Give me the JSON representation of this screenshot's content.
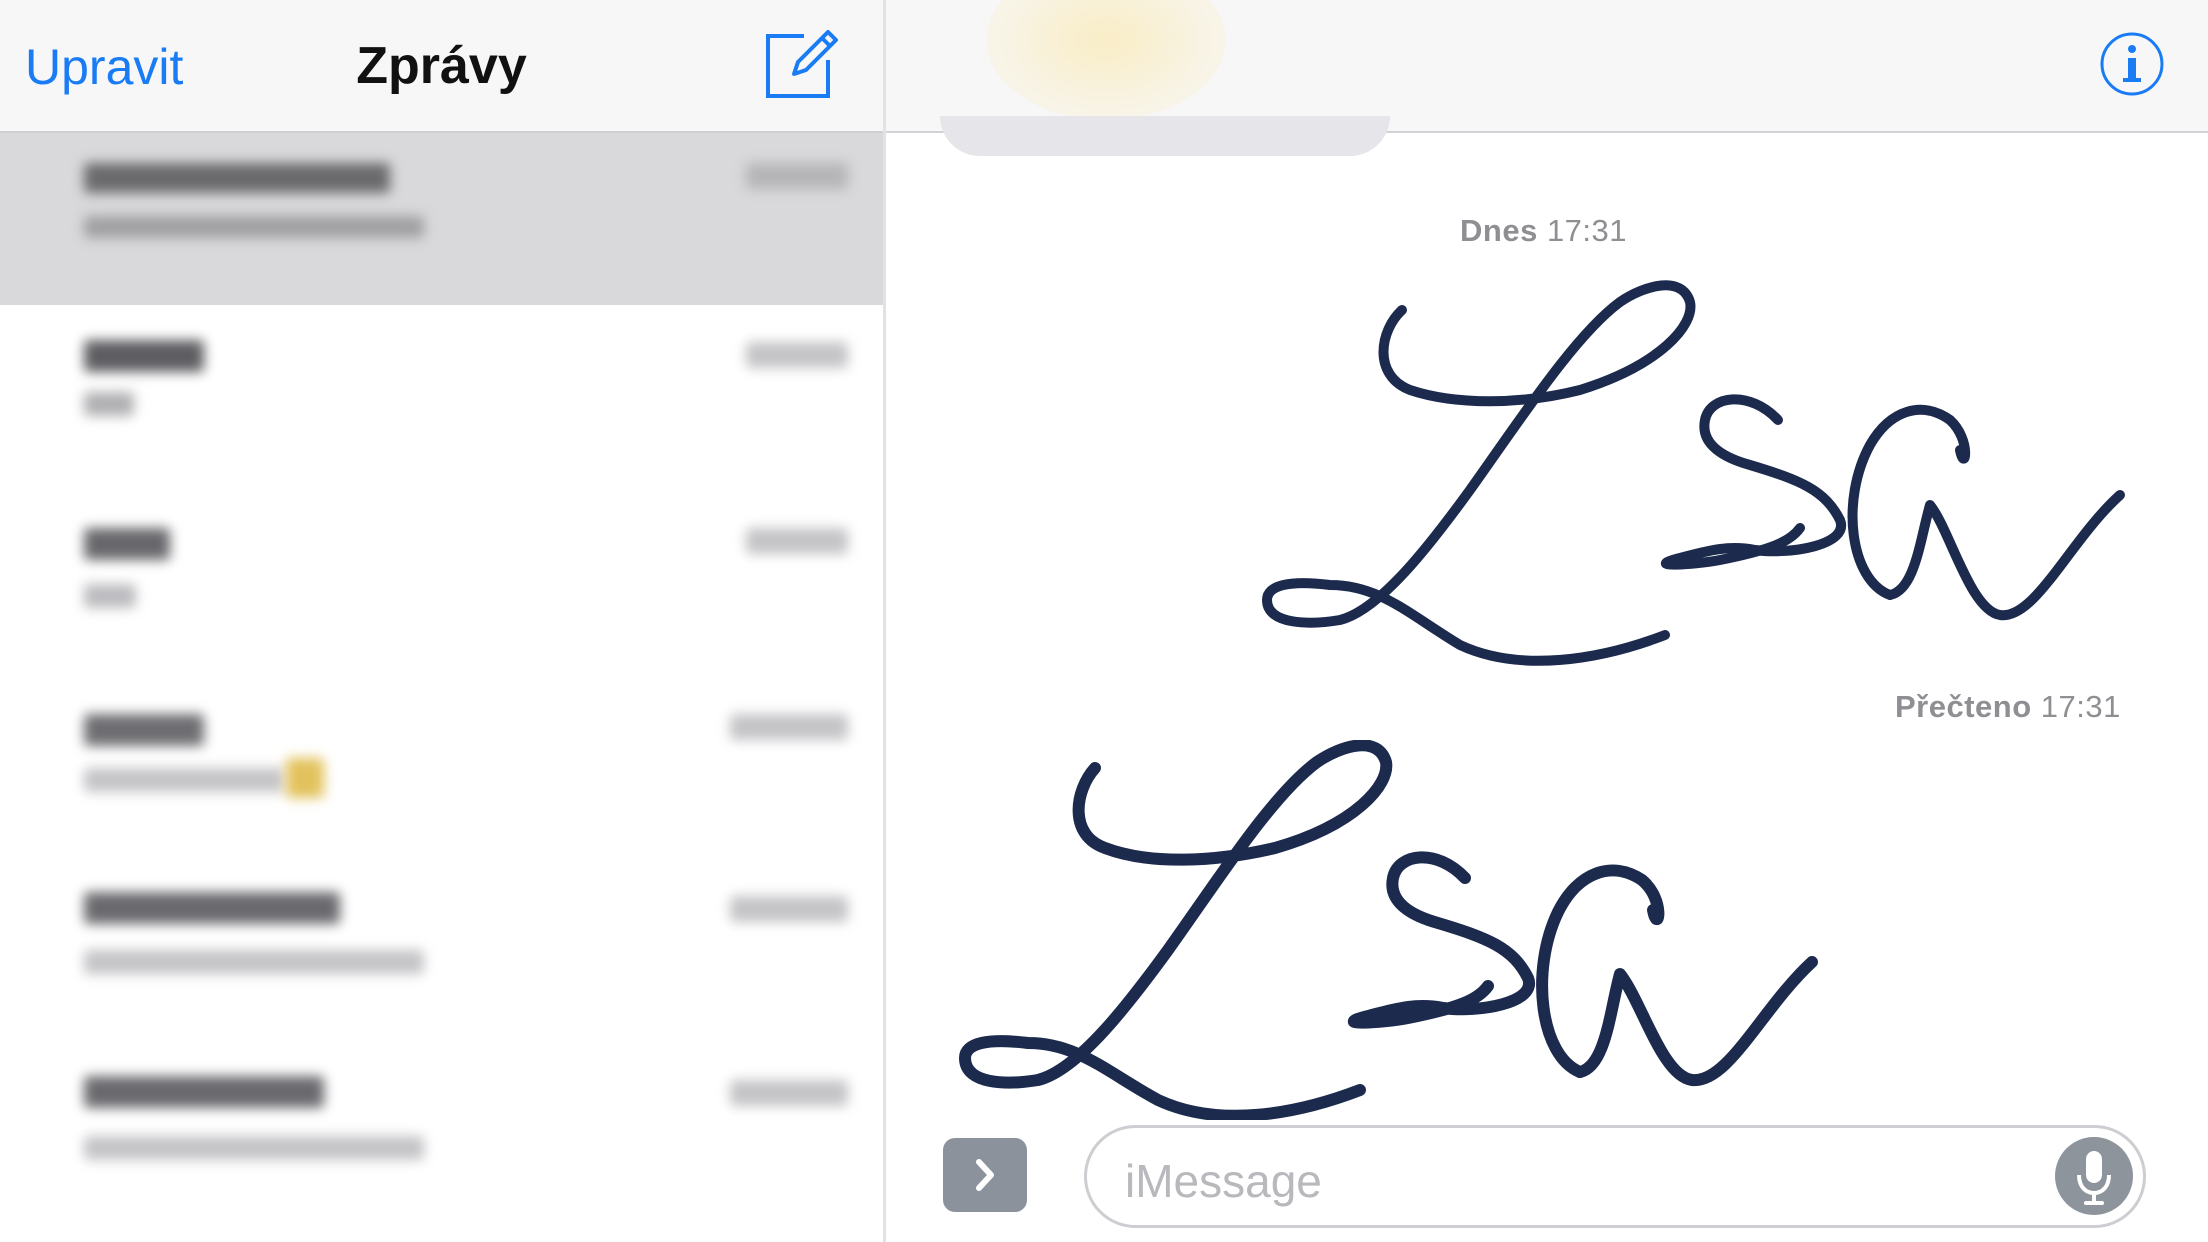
{
  "sidebar": {
    "edit_label": "Upravit",
    "title": "Zprávy"
  },
  "conversation": {
    "timestamp_day": "Dnes",
    "timestamp_time": "17:31",
    "read_label": "Přečteno",
    "read_time": "17:31",
    "handwriting_text": "Lisa"
  },
  "composer": {
    "placeholder": "iMessage"
  },
  "colors": {
    "accent": "#1a7cf5",
    "ink": "#1c2a4d",
    "muted": "#8e8e93"
  }
}
